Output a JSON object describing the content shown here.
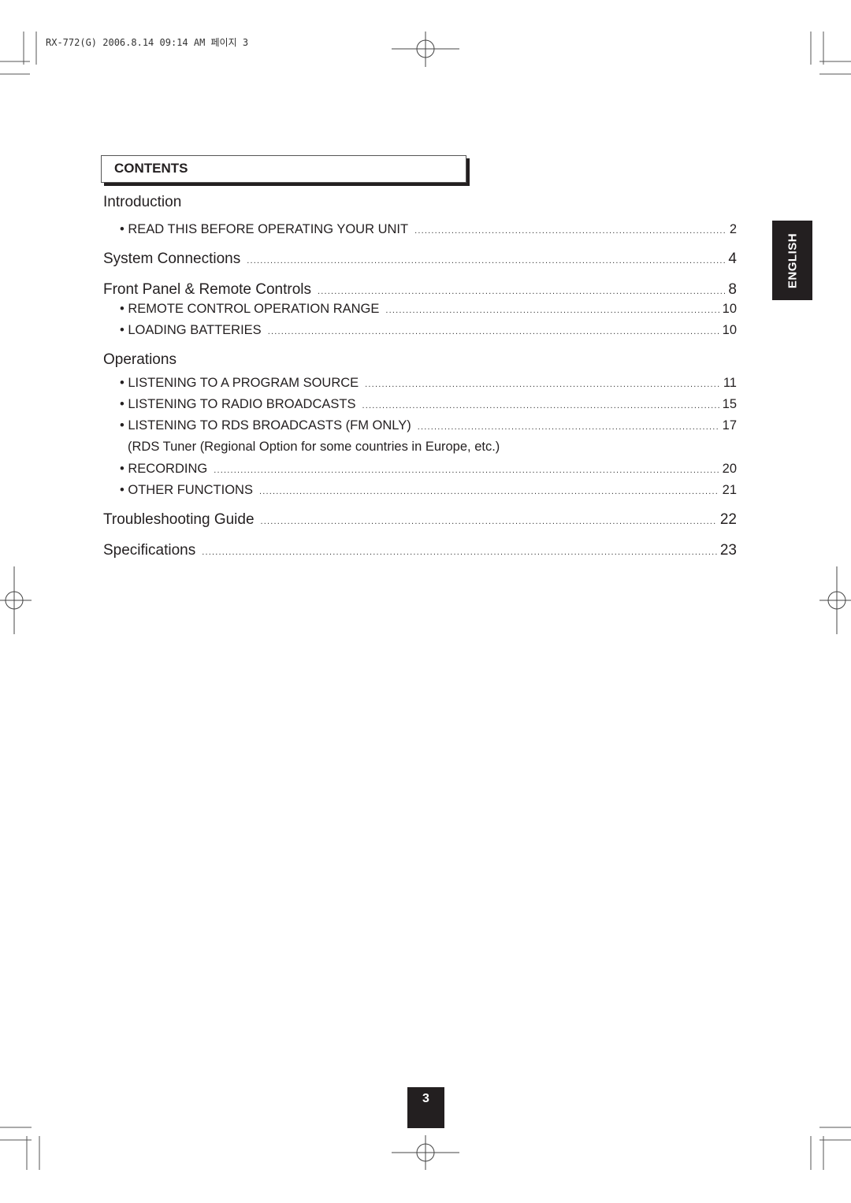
{
  "print_slug": "RX-772(G)  2006.8.14  09:14 AM 페이지 3",
  "contents_title": "CONTENTS",
  "language_tab": "ENGLISH",
  "page_number": "3",
  "toc": {
    "introduction": {
      "heading": "Introduction",
      "items": [
        {
          "label": "READ THIS BEFORE OPERATING YOUR UNIT",
          "page": "2"
        }
      ]
    },
    "system_connections": {
      "label": "System Connections",
      "page": "4"
    },
    "front_panel": {
      "label": "Front Panel & Remote Controls",
      "page": "8",
      "items": [
        {
          "label": "REMOTE CONTROL OPERATION RANGE",
          "page": "10"
        },
        {
          "label": "LOADING BATTERIES",
          "page": "10"
        }
      ]
    },
    "operations": {
      "heading": "Operations",
      "items": [
        {
          "label": "LISTENING TO A PROGRAM SOURCE",
          "page": "11"
        },
        {
          "label": "LISTENING TO RADIO BROADCASTS",
          "page": "15"
        },
        {
          "label": "LISTENING TO RDS BROADCASTS (FM ONLY)",
          "page": "17"
        },
        {
          "label": "RECORDING",
          "page": "20"
        },
        {
          "label": "OTHER FUNCTIONS",
          "page": "21"
        }
      ],
      "note": "(RDS Tuner (Regional Option for some countries in Europe, etc.)"
    },
    "troubleshooting": {
      "label": "Troubleshooting Guide",
      "page": "22"
    },
    "specifications": {
      "label": "Specifications",
      "page": "23"
    }
  }
}
